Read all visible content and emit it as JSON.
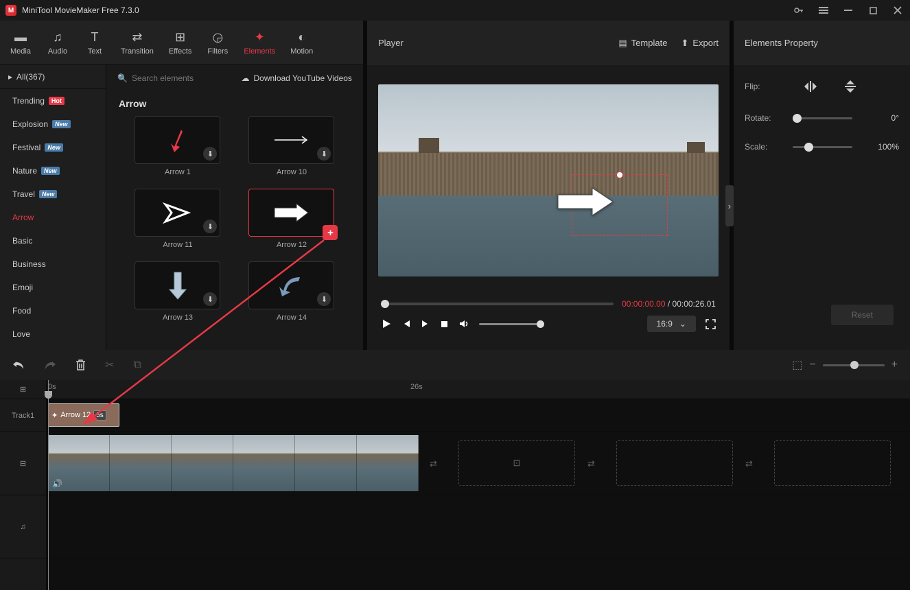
{
  "app": {
    "title": "MiniTool MovieMaker Free 7.3.0"
  },
  "toolbar": {
    "media": "Media",
    "audio": "Audio",
    "text": "Text",
    "transition": "Transition",
    "effects": "Effects",
    "filters": "Filters",
    "elements": "Elements",
    "motion": "Motion"
  },
  "categories": {
    "header": "All(367)",
    "items": [
      {
        "label": "Trending",
        "badge": "Hot"
      },
      {
        "label": "Explosion",
        "badge": "New"
      },
      {
        "label": "Festival",
        "badge": "New"
      },
      {
        "label": "Nature",
        "badge": "New"
      },
      {
        "label": "Travel",
        "badge": "New"
      },
      {
        "label": "Arrow",
        "active": true
      },
      {
        "label": "Basic"
      },
      {
        "label": "Business"
      },
      {
        "label": "Emoji"
      },
      {
        "label": "Food"
      },
      {
        "label": "Love"
      }
    ]
  },
  "search": {
    "placeholder": "Search elements",
    "download_link": "Download YouTube Videos"
  },
  "section": {
    "title": "Arrow"
  },
  "elements": {
    "a1": "Arrow 1",
    "a10": "Arrow 10",
    "a11": "Arrow 11",
    "a12": "Arrow 12",
    "a13": "Arrow 13",
    "a14": "Arrow 14"
  },
  "player": {
    "title": "Player",
    "template": "Template",
    "export": "Export",
    "time_cur": "00:00:00.00",
    "time_sep": " / ",
    "time_total": "00:00:26.01",
    "aspect": "16:9"
  },
  "props": {
    "title": "Elements Property",
    "flip": "Flip:",
    "rotate": "Rotate:",
    "scale": "Scale:",
    "rotate_val": "0°",
    "scale_val": "100%",
    "reset": "Reset"
  },
  "timeline": {
    "t0": "0s",
    "t26": "26s",
    "track1": "Track1",
    "clip_name": "Arrow 12",
    "clip_dur": "5s"
  }
}
